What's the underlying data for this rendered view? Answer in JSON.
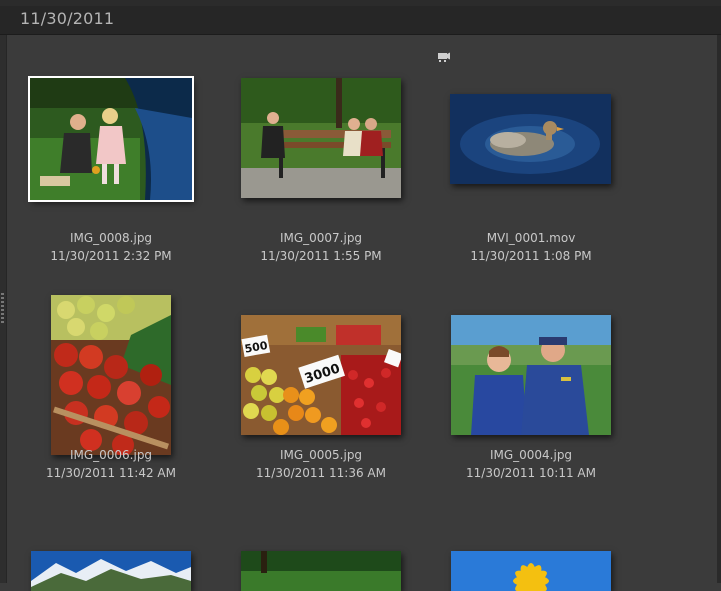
{
  "header": {
    "date": "11/30/2011"
  },
  "items": [
    {
      "name": "IMG_0008.jpg",
      "time": "11/30/2011 2:32 PM"
    },
    {
      "name": "IMG_0007.jpg",
      "time": "11/30/2011 1:55 PM"
    },
    {
      "name": "MVI_0001.mov",
      "time": "11/30/2011 1:08 PM"
    },
    {
      "name": "IMG_0006.jpg",
      "time": "11/30/2011 11:42 AM"
    },
    {
      "name": "IMG_0005.jpg",
      "time": "11/30/2011 11:36 AM"
    },
    {
      "name": "IMG_0004.jpg",
      "time": "11/30/2011 10:11 AM"
    },
    {
      "sign_500": "500",
      "sign_3000": "3000"
    }
  ],
  "icons": {
    "video_badge": "video-camera-icon",
    "resize": "drag-grip-icon"
  },
  "colors": {
    "background": "#3b3b3b",
    "header": "#262626",
    "text": "#c8c8c8",
    "selection": "#ffffff"
  }
}
